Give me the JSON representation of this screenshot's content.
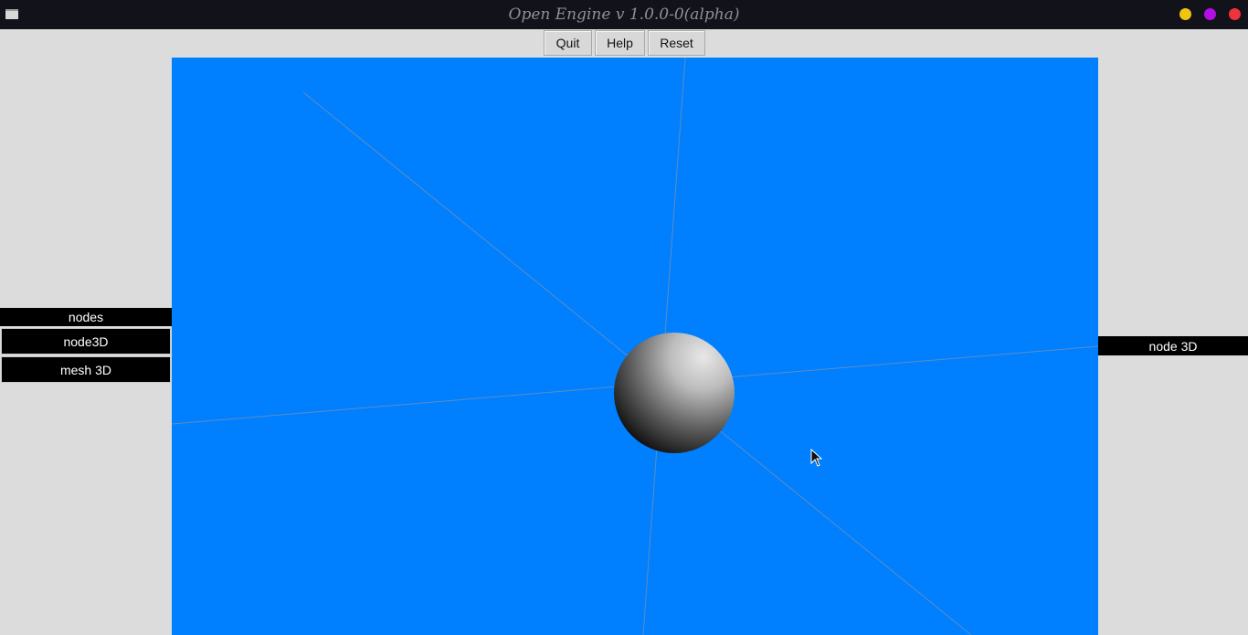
{
  "window": {
    "title": "Open Engine v 1.0.0-0(alpha)",
    "controls": {
      "minimize_color": "#f1c40f",
      "maximize_color": "#b30ee6",
      "close_color": "#f0323c"
    }
  },
  "toolbar": {
    "quit_label": "Quit",
    "help_label": "Help",
    "reset_label": "Reset"
  },
  "left_panel": {
    "header": "nodes",
    "items": [
      {
        "label": "node3D"
      },
      {
        "label": "mesh 3D"
      }
    ]
  },
  "right_panel": {
    "header": "node 3D"
  },
  "viewport": {
    "background_color": "#007fff",
    "objects": [
      "sphere"
    ]
  }
}
